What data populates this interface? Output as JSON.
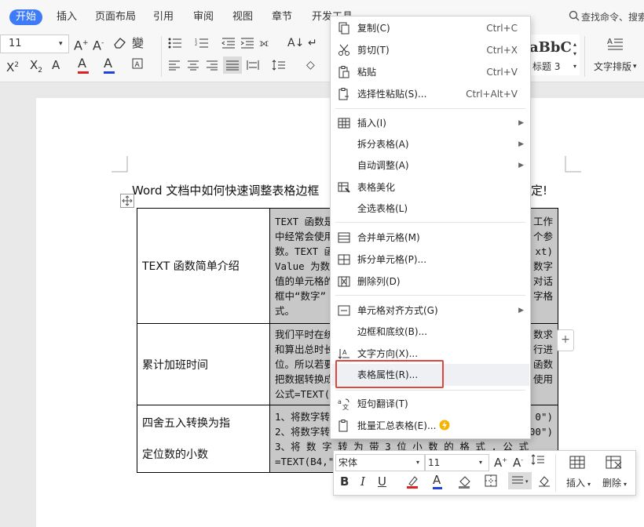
{
  "tabs": [
    {
      "label": "开始",
      "active": true
    },
    {
      "label": "插入"
    },
    {
      "label": "页面布局"
    },
    {
      "label": "引用"
    },
    {
      "label": "审阅"
    },
    {
      "label": "视图"
    },
    {
      "label": "章节"
    },
    {
      "label": "开发工具"
    }
  ],
  "search": {
    "label": "查找命令、搜索"
  },
  "ribbon": {
    "font_size": "11",
    "style_preview": "aBbC",
    "style_name": "标题 3",
    "text_layout": "文字排版"
  },
  "document": {
    "title": "Word 文档中如何快速调整表格边框",
    "title_end": "定!",
    "rows": [
      {
        "label": "TEXT 函数简单介绍",
        "lines": [
          "TEXT 函数是",
          "中经常会使用",
          "数。TEXT 函",
          "Value 为数值",
          "值的单元格的",
          "框中“数字”",
          "式。"
        ],
        "right": [
          "工作",
          "个参",
          "xt)",
          "数字",
          "对话",
          "字格",
          ""
        ]
      },
      {
        "label": "累计加班时间",
        "lines": [
          "我们平时在统",
          "和算出总时长",
          "位。所以若要",
          "把数据转换成",
          "公式=TEXT(S"
        ],
        "right": [
          "数求",
          "行进",
          "函数",
          "使用",
          ""
        ]
      },
      {
        "label": "四舍五入转换为指定位数的小数",
        "label_lines": [
          "四舍五入转换为指",
          "定位数的小数"
        ],
        "lines": [
          "1、将数字转",
          "2、将数字转",
          "3、将 数 字 转 为 带 3 位 小 数 的 格 式 , 公 式",
          "=TEXT(B4,\"0."
        ],
        "right": [
          "0\")",
          "00\")",
          "",
          ""
        ]
      }
    ]
  },
  "context_menu": {
    "items": [
      {
        "label": "复制(C)",
        "shortcut": "Ctrl+C",
        "icon": "copy-icon"
      },
      {
        "label": "剪切(T)",
        "shortcut": "Ctrl+X",
        "icon": "scissors-icon"
      },
      {
        "label": "粘贴",
        "shortcut": "Ctrl+V",
        "icon": "paste-icon"
      },
      {
        "label": "选择性粘贴(S)...",
        "shortcut": "Ctrl+Alt+V",
        "icon": "paste-special-icon"
      },
      {
        "label": "插入(I)",
        "icon": "table-insert-icon",
        "submenu": true
      },
      {
        "label": "拆分表格(A)",
        "submenu": true
      },
      {
        "label": "自动调整(A)",
        "submenu": true
      },
      {
        "label": "表格美化",
        "icon": "table-beautify-icon"
      },
      {
        "label": "全选表格(L)"
      },
      {
        "label": "合并单元格(M)",
        "icon": "merge-cells-icon"
      },
      {
        "label": "拆分单元格(P)...",
        "icon": "split-cells-icon"
      },
      {
        "label": "删除列(D)",
        "icon": "delete-column-icon"
      },
      {
        "label": "单元格对齐方式(G)",
        "icon": "cell-align-icon",
        "submenu": true
      },
      {
        "label": "边框和底纹(B)..."
      },
      {
        "label": "文字方向(X)...",
        "icon": "text-direction-icon"
      },
      {
        "label": "表格属性(R)...",
        "highlighted": true
      },
      {
        "label": "短句翻译(T)",
        "icon": "translate-icon"
      },
      {
        "label": "批量汇总表格(E)...",
        "icon": "batch-summary-icon",
        "badge": "lightning-icon"
      }
    ]
  },
  "mini_toolbar": {
    "font_name": "宋体",
    "font_size": "11",
    "insert_label": "插入",
    "delete_label": "删除"
  },
  "colors": {
    "accent": "#3e7bf6",
    "highlight_border": "#e0463c",
    "font_color_red": "#e02020",
    "font_color_blue": "#2040e0",
    "cell_gray": "#c8c8c8"
  }
}
